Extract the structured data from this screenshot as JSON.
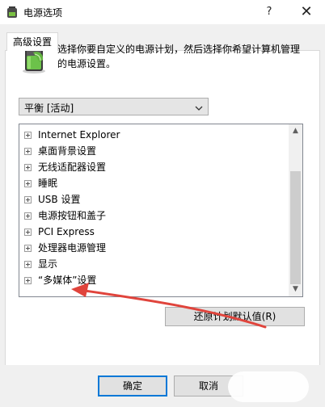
{
  "window": {
    "title": "电源选项",
    "help_glyph": "?",
    "close_glyph": "✕"
  },
  "tabs": [
    {
      "label": "高级设置"
    }
  ],
  "description": {
    "line1": "选择你要自定义的电源计划，然后选择你希望计算机管理",
    "line2": "的电源设置。"
  },
  "plan_select": {
    "value": "平衡 [活动]"
  },
  "tree": {
    "items": [
      {
        "label": "Internet Explorer"
      },
      {
        "label": "桌面背景设置"
      },
      {
        "label": "无线适配器设置"
      },
      {
        "label": "睡眠"
      },
      {
        "label": "USB 设置"
      },
      {
        "label": "电源按钮和盖子"
      },
      {
        "label": "PCI Express"
      },
      {
        "label": "处理器电源管理"
      },
      {
        "label": "显示"
      },
      {
        "label": "“多媒体”设置"
      }
    ]
  },
  "buttons": {
    "restore_defaults": "还原计划默认值(R)",
    "ok": "确定",
    "cancel": "取消"
  },
  "colors": {
    "annotation_arrow": "#e0443c",
    "focus_border": "#0078d7",
    "panel_bg": "#f0f0f0"
  }
}
